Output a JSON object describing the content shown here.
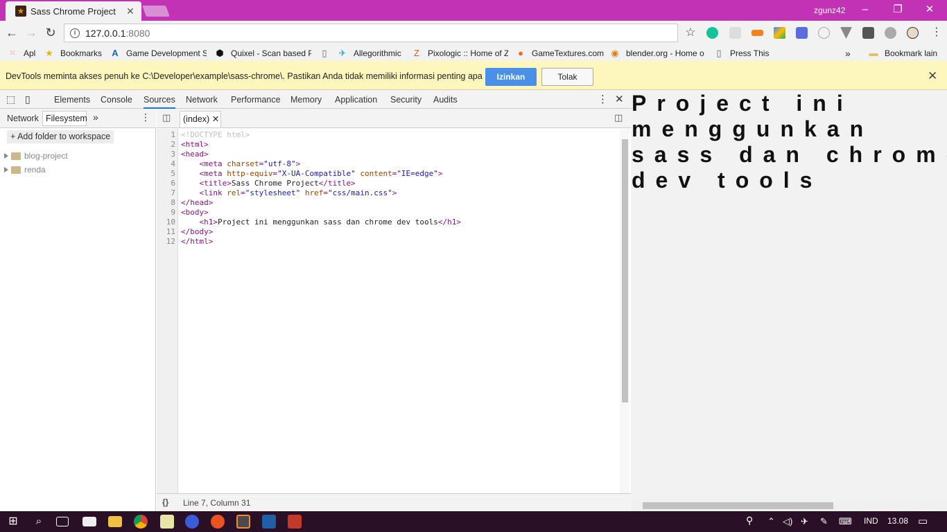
{
  "browser": {
    "tab_title": "Sass Chrome Project",
    "tab_close": "✕",
    "user": "zgunz42",
    "url_host": "127.0.0.1",
    "url_port": ":8080",
    "accent": "#c232b5"
  },
  "bookmarks": [
    {
      "label": "Apl",
      "icon": "apps-grid-icon"
    },
    {
      "label": "Bookmarks",
      "icon": "star-icon"
    },
    {
      "label": "Game Development S",
      "icon": "unreal-icon"
    },
    {
      "label": "Quixel - Scan based P",
      "icon": "quixel-icon"
    },
    {
      "label": "",
      "icon": "page-icon"
    },
    {
      "label": "Allegorithmic",
      "icon": "allegorithmic-icon"
    },
    {
      "label": "Pixologic :: Home of Z",
      "icon": "pixologic-icon"
    },
    {
      "label": "GameTextures.com",
      "icon": "gametextures-icon"
    },
    {
      "label": "blender.org - Home o",
      "icon": "blender-icon"
    },
    {
      "label": "Press This",
      "icon": "page-icon"
    },
    {
      "label": "Bookmark lain",
      "icon": "folder-icon"
    }
  ],
  "infobar": {
    "message": "DevTools meminta akses penuh ke C:\\Developer\\example\\sass-chrome\\. Pastikan Anda tidak memiliki informasi penting apa pun.",
    "allow_label": "Izinkan",
    "deny_label": "Tolak"
  },
  "devtools": {
    "tabs": [
      "Elements",
      "Console",
      "Sources",
      "Network",
      "Performance",
      "Memory",
      "Application",
      "Security",
      "Audits"
    ],
    "active_tab": "Sources",
    "navigator_tabs": [
      "Network",
      "Filesystem"
    ],
    "add_folder_label": "Add folder to workspace",
    "folders": [
      "blog-project",
      "renda"
    ],
    "open_file": "(index)",
    "line_numbers": [
      "1",
      "2",
      "3",
      "4",
      "5",
      "6",
      "7",
      "8",
      "9",
      "10",
      "11",
      "12"
    ],
    "status": "Line 7, Column 31",
    "format_icon_label": "{}"
  },
  "page": {
    "heading": "Project ini menggunkan sass dan chrome dev tools"
  },
  "taskbar": {
    "language": "IND",
    "time": "13.08"
  }
}
